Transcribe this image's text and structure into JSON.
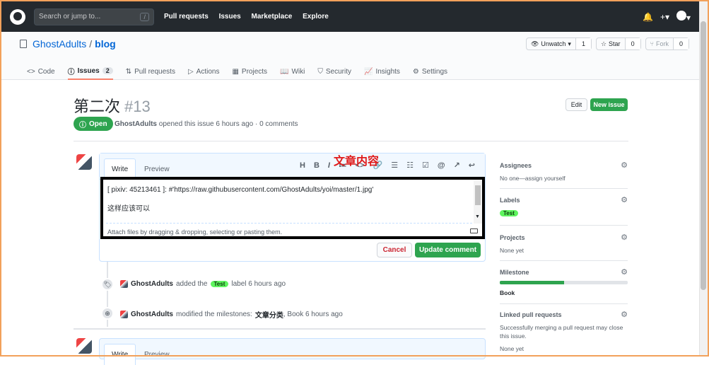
{
  "header": {
    "search_placeholder": "Search or jump to...",
    "search_key": "/",
    "nav": [
      "Pull requests",
      "Issues",
      "Marketplace",
      "Explore"
    ]
  },
  "repo": {
    "owner": "GhostAdults",
    "separator": "/",
    "name": "blog",
    "unwatch_label": "Unwatch",
    "watch_count": "1",
    "star_label": "Star",
    "star_count": "0",
    "fork_label": "Fork",
    "fork_count": "0",
    "tabs": [
      {
        "label": "Code",
        "icon": "code-icon"
      },
      {
        "label": "Issues",
        "count": "2",
        "icon": "issue-icon"
      },
      {
        "label": "Pull requests",
        "icon": "pull-request-icon"
      },
      {
        "label": "Actions",
        "icon": "play-icon"
      },
      {
        "label": "Projects",
        "icon": "project-icon"
      },
      {
        "label": "Wiki",
        "icon": "book-icon"
      },
      {
        "label": "Security",
        "icon": "shield-icon"
      },
      {
        "label": "Insights",
        "icon": "graph-icon"
      },
      {
        "label": "Settings",
        "icon": "gear-icon"
      }
    ]
  },
  "issue": {
    "title": "第二次",
    "number": "#13",
    "edit_label": "Edit",
    "new_issue_label": "New issue",
    "state": "Open",
    "author": "GhostAdults",
    "meta_text": "opened this issue 6 hours ago · 0 comments"
  },
  "editor": {
    "tab_write": "Write",
    "tab_preview": "Preview",
    "annotation": "文章内容",
    "line1": "[ pixiv: 45213461 ]: #'https://raw.githubusercontent.com/GhostAdults/yoi/master/1.jpg'",
    "line2": "这样应该可以",
    "footer": "Attach files by dragging & dropping, selecting or pasting them.",
    "cancel_label": "Cancel",
    "update_label": "Update comment",
    "toolbar": [
      "H",
      "B",
      "I",
      "≔",
      "<>",
      "🔗",
      "☰",
      "☷",
      "☑",
      "@",
      "↗",
      "↩"
    ]
  },
  "timeline": [
    {
      "user": "GhostAdults",
      "before": "added the",
      "label": "Test",
      "after": "label 6 hours ago"
    },
    {
      "user": "GhostAdults",
      "before": "modified the milestones:",
      "strong": "文章分类",
      "after": ", Book 6 hours ago"
    }
  ],
  "sidebar": {
    "assignees_title": "Assignees",
    "assignees_value": "No one—assign yourself",
    "labels_title": "Labels",
    "labels_value": "Test",
    "projects_title": "Projects",
    "projects_value": "None yet",
    "milestone_title": "Milestone",
    "milestone_progress": 0.5,
    "milestone_value": "Book",
    "linked_title": "Linked pull requests",
    "linked_value": "Successfully merging a pull request may close this issue.",
    "linked_none": "None yet"
  },
  "colors": {
    "accent_green": "#2ea44f",
    "label_green": "#5ff55f",
    "annotation_red": "#e01b1b"
  }
}
